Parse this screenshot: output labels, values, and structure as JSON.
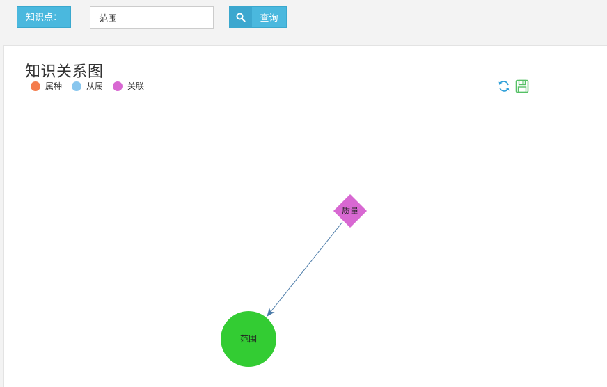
{
  "toolbar": {
    "field_label": "知识点：",
    "search_value": "范围",
    "search_placeholder": "",
    "query_label": "查询"
  },
  "panel": {
    "title": "知识关系图",
    "legend": [
      {
        "label": "属种",
        "color": "#f47c4c"
      },
      {
        "label": "从属",
        "color": "#88c6ee"
      },
      {
        "label": "关联",
        "color": "#d868d2"
      }
    ],
    "tools": {
      "refresh": "refresh-icon",
      "save": "save-icon"
    }
  },
  "graph": {
    "nodes": [
      {
        "id": "zhiliang",
        "label": "质量",
        "shape": "diamond",
        "color": "#d868d2"
      },
      {
        "id": "fanwei",
        "label": "范围",
        "shape": "circle",
        "color": "#33cc33"
      }
    ],
    "edges": [
      {
        "from": "zhiliang",
        "to": "fanwei",
        "color": "#4a7aa8"
      }
    ]
  }
}
